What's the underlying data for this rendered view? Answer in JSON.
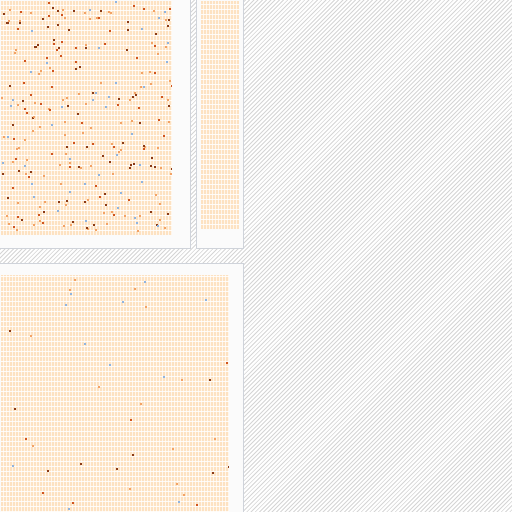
{
  "window": {
    "panels": [
      {
        "id": "top-left",
        "kind": "thumbnail",
        "tint": "#fde2c2",
        "accent": "#d0541e"
      },
      {
        "id": "top-right",
        "kind": "thumbnail",
        "tint": "#fde2c2",
        "accent": "#f2a266"
      },
      {
        "id": "bottom",
        "kind": "thumbnail",
        "tint": "#fde2c2",
        "accent": "#d0541e"
      }
    ],
    "background_pattern": "diagonal-hatch"
  }
}
